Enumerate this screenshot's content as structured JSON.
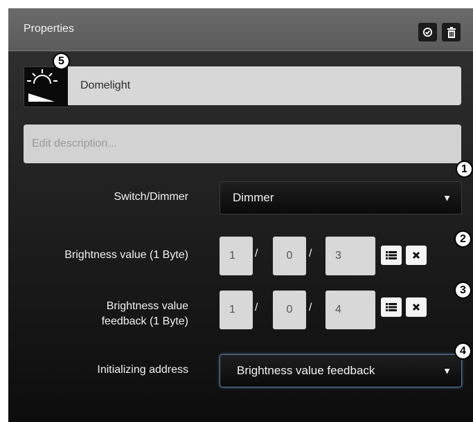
{
  "header": {
    "title": "Properties",
    "buttons": [
      {
        "icon": "check-circle-icon"
      },
      {
        "icon": "trash-icon"
      }
    ]
  },
  "device": {
    "icon": "dimmable-light-icon",
    "name": "Domelight"
  },
  "description": {
    "placeholder": "Edit description..."
  },
  "fields": {
    "switch_dimmer": {
      "label": "Switch/Dimmer",
      "value": "Dimmer"
    },
    "brightness": {
      "label": "Brightness value (1 Byte)",
      "address": [
        "1",
        "0",
        "3"
      ]
    },
    "brightness_feedback": {
      "label_line1": "Brightness value",
      "label_line2": "feedback (1 Byte)",
      "address": [
        "1",
        "0",
        "4"
      ]
    },
    "initializing": {
      "label": "Initializing address",
      "value": "Brightness value feedback"
    }
  },
  "separator": "/",
  "badges": [
    "1",
    "2",
    "3",
    "4",
    "5"
  ],
  "colors": {
    "header_bg": "#5c5c5c",
    "panel_bg": "#1b1b1b",
    "field_bg": "#d7d7d7",
    "text_light": "#f2f2f2"
  }
}
